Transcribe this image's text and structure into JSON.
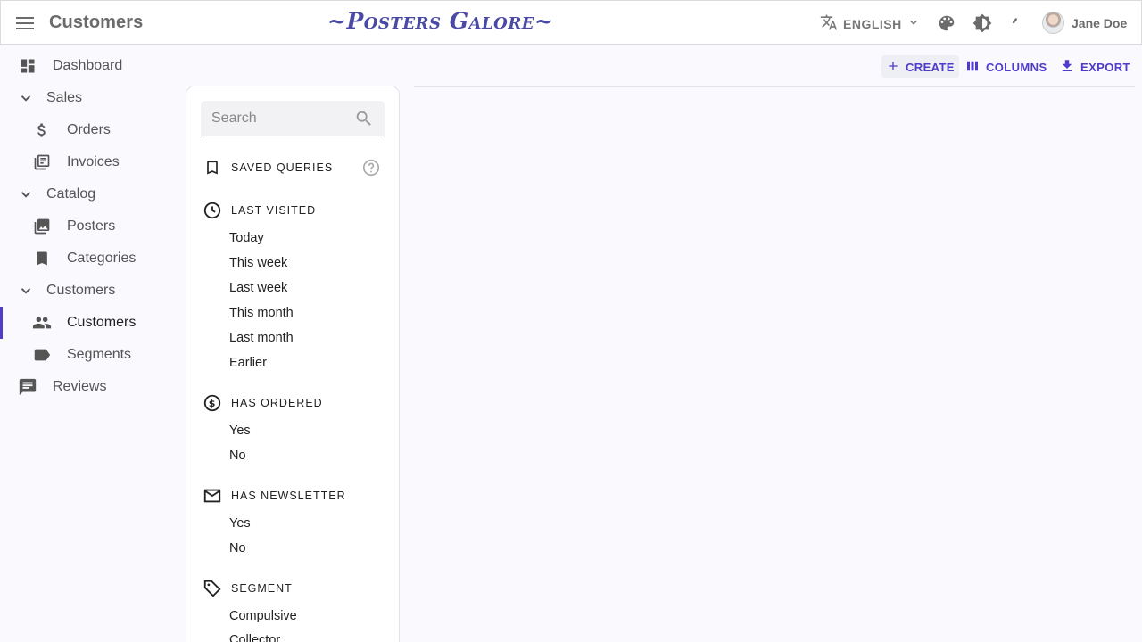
{
  "header": {
    "title": "Customers",
    "brand": "~Posters Galore~",
    "language": "ENGLISH",
    "user_name": "Jane Doe"
  },
  "sidebar": {
    "items": [
      {
        "label": "Dashboard",
        "icon": "dashboard-icon"
      },
      {
        "label": "Sales",
        "icon": "chevron-down-icon"
      },
      {
        "label": "Orders",
        "icon": "dollar-icon"
      },
      {
        "label": "Invoices",
        "icon": "library-books-icon"
      },
      {
        "label": "Catalog",
        "icon": "chevron-down-icon"
      },
      {
        "label": "Posters",
        "icon": "collections-icon"
      },
      {
        "label": "Categories",
        "icon": "bookmark-icon"
      },
      {
        "label": "Customers",
        "icon": "chevron-down-icon"
      },
      {
        "label": "Customers",
        "icon": "people-icon"
      },
      {
        "label": "Segments",
        "icon": "label-icon"
      },
      {
        "label": "Reviews",
        "icon": "comment-icon"
      }
    ]
  },
  "filters": {
    "search_placeholder": "Search",
    "saved_queries": "SAVED QUERIES",
    "last_visited": {
      "title": "LAST VISITED",
      "options": [
        "Today",
        "This week",
        "Last week",
        "This month",
        "Last month",
        "Earlier"
      ]
    },
    "has_ordered": {
      "title": "HAS ORDERED",
      "options": [
        "Yes",
        "No"
      ]
    },
    "has_newsletter": {
      "title": "HAS NEWSLETTER",
      "options": [
        "Yes",
        "No"
      ]
    },
    "segment": {
      "title": "SEGMENT",
      "options": [
        "Compulsive",
        "Collector"
      ]
    }
  },
  "toolbar": {
    "create": "CREATE",
    "columns": "COLUMNS",
    "export": "EXPORT"
  },
  "colors": {
    "accent": "#4f3cc9",
    "brand": "#4a4aa6"
  }
}
